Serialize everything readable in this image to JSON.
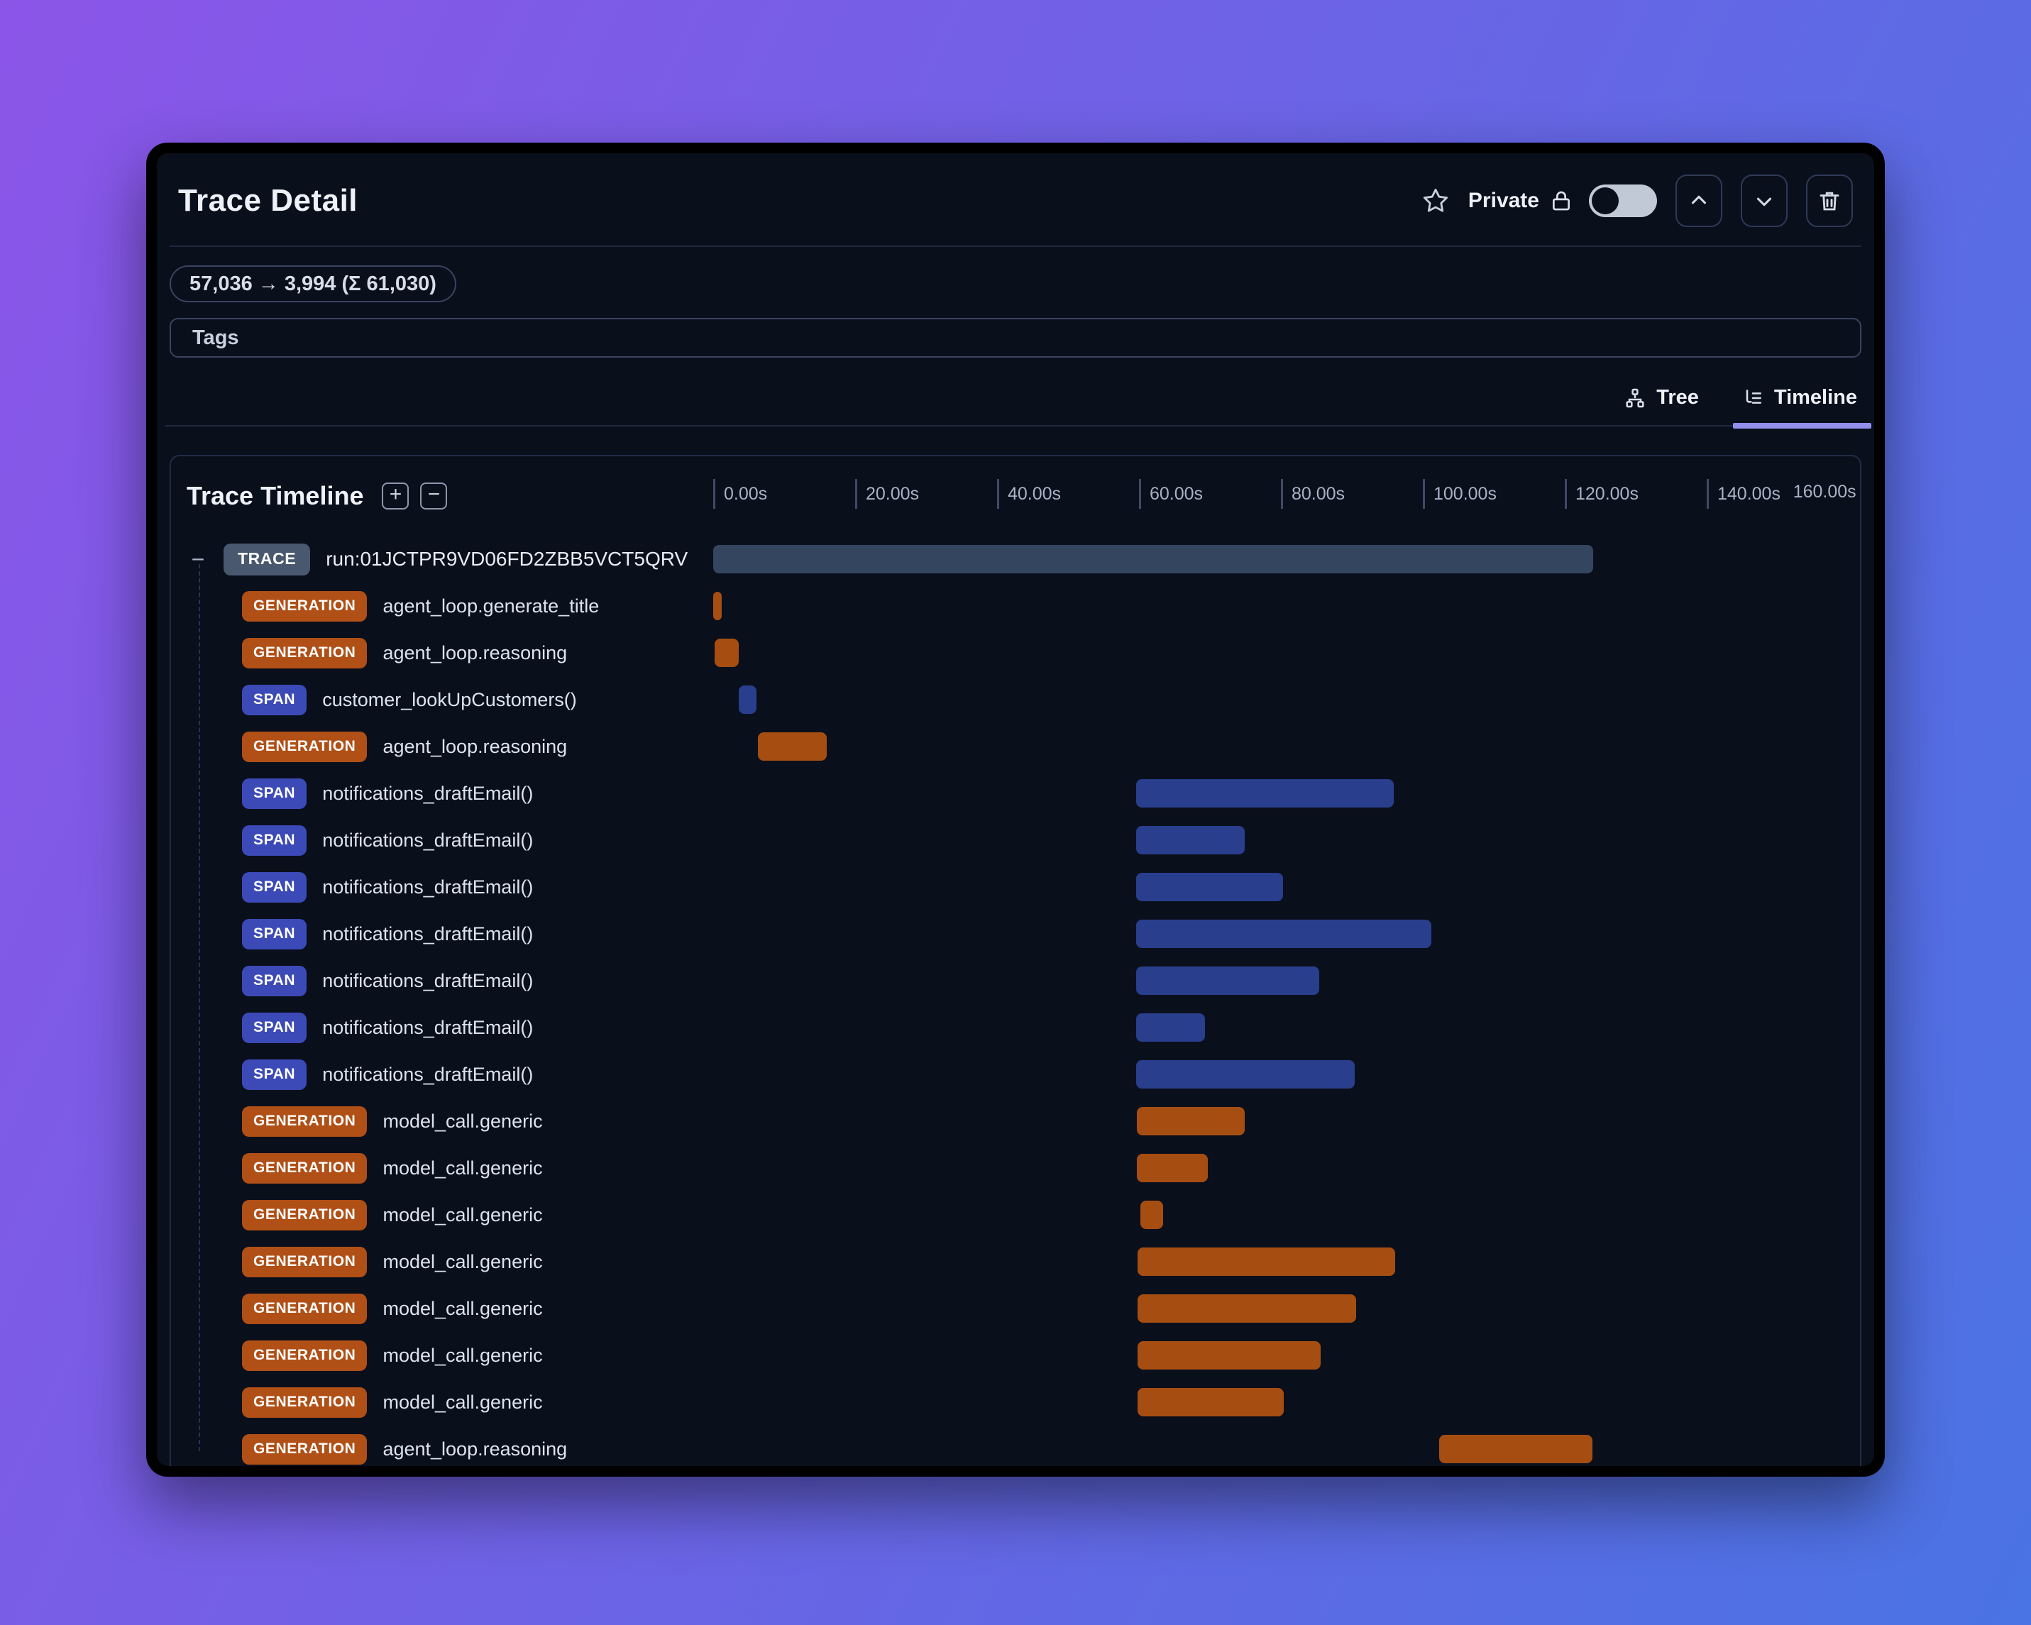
{
  "header": {
    "title": "Trace Detail",
    "privacy_label": "Private",
    "star_icon": "star-outline",
    "lock_icon": "padlock",
    "toggle_state": "off",
    "up_button_icon": "chevron-up",
    "down_button_icon": "chevron-down",
    "delete_button_icon": "trash"
  },
  "token_badge": "57,036 → 3,994 (Σ 61,030)",
  "tags": {
    "label": "Tags"
  },
  "tabs": [
    {
      "label": "Tree",
      "icon": "hierarchy-icon",
      "active": false
    },
    {
      "label": "Timeline",
      "icon": "list-tree-icon",
      "active": true
    }
  ],
  "timeline": {
    "title": "Trace Timeline",
    "expand_all_glyph": "+",
    "collapse_all_glyph": "−",
    "collapse_trace_glyph": "−",
    "axis": {
      "unit": "s",
      "max_s": 160,
      "ticks": [
        {
          "t": 0,
          "label": "0.00s"
        },
        {
          "t": 20,
          "label": "20.00s"
        },
        {
          "t": 40,
          "label": "40.00s"
        },
        {
          "t": 60,
          "label": "60.00s"
        },
        {
          "t": 80,
          "label": "80.00s"
        },
        {
          "t": 100,
          "label": "100.00s"
        },
        {
          "t": 120,
          "label": "120.00s"
        },
        {
          "t": 140,
          "label": "140.00s"
        }
      ],
      "end_label": "160.00s"
    },
    "rows": [
      {
        "kind": "trace",
        "badge": "TRACE",
        "label": "run:01JCTPR9VD06FD2ZBB5VCT5QRV",
        "start_s": 0,
        "end_s": 124.0
      },
      {
        "kind": "generation",
        "badge": "GENERATION",
        "label": "agent_loop.generate_title",
        "start_s": 0,
        "end_s": 1.2
      },
      {
        "kind": "generation",
        "badge": "GENERATION",
        "label": "agent_loop.reasoning",
        "start_s": 0.2,
        "end_s": 3.6
      },
      {
        "kind": "span",
        "badge": "SPAN",
        "label": "customer_lookUpCustomers()",
        "start_s": 3.6,
        "end_s": 6.1
      },
      {
        "kind": "generation",
        "badge": "GENERATION",
        "label": "agent_loop.reasoning",
        "start_s": 6.3,
        "end_s": 16.0
      },
      {
        "kind": "span",
        "badge": "SPAN",
        "label": "notifications_draftEmail()",
        "start_s": 59.6,
        "end_s": 95.9
      },
      {
        "kind": "span",
        "badge": "SPAN",
        "label": "notifications_draftEmail()",
        "start_s": 59.6,
        "end_s": 74.9
      },
      {
        "kind": "span",
        "badge": "SPAN",
        "label": "notifications_draftEmail()",
        "start_s": 59.6,
        "end_s": 80.3
      },
      {
        "kind": "span",
        "badge": "SPAN",
        "label": "notifications_draftEmail()",
        "start_s": 59.6,
        "end_s": 101.2
      },
      {
        "kind": "span",
        "badge": "SPAN",
        "label": "notifications_draftEmail()",
        "start_s": 59.6,
        "end_s": 85.4
      },
      {
        "kind": "span",
        "badge": "SPAN",
        "label": "notifications_draftEmail()",
        "start_s": 59.6,
        "end_s": 69.3
      },
      {
        "kind": "span",
        "badge": "SPAN",
        "label": "notifications_draftEmail()",
        "start_s": 59.6,
        "end_s": 90.4
      },
      {
        "kind": "generation",
        "badge": "GENERATION",
        "label": "model_call.generic",
        "start_s": 59.7,
        "end_s": 74.9
      },
      {
        "kind": "generation",
        "badge": "GENERATION",
        "label": "model_call.generic",
        "start_s": 59.7,
        "end_s": 69.7
      },
      {
        "kind": "generation",
        "badge": "GENERATION",
        "label": "model_call.generic",
        "start_s": 60.2,
        "end_s": 63.4
      },
      {
        "kind": "generation",
        "badge": "GENERATION",
        "label": "model_call.generic",
        "start_s": 59.8,
        "end_s": 96.1
      },
      {
        "kind": "generation",
        "badge": "GENERATION",
        "label": "model_call.generic",
        "start_s": 59.8,
        "end_s": 90.6
      },
      {
        "kind": "generation",
        "badge": "GENERATION",
        "label": "model_call.generic",
        "start_s": 59.8,
        "end_s": 85.6
      },
      {
        "kind": "generation",
        "badge": "GENERATION",
        "label": "model_call.generic",
        "start_s": 59.8,
        "end_s": 80.4
      },
      {
        "kind": "generation",
        "badge": "GENERATION",
        "label": "agent_loop.reasoning",
        "start_s": 102.3,
        "end_s": 123.9
      }
    ]
  },
  "colors": {
    "background_gradient_from": "#8b55e8",
    "background_gradient_to": "#4a73e3",
    "panel_background": "#0a0f1c",
    "active_tab_underline": "#938fed",
    "trace_badge": "#49586e",
    "trace_bar": "#34455f",
    "generation_badge": "#b04f16",
    "generation_bar": "#a64e12",
    "span_badge": "#3c4ab8",
    "span_bar": "#2a3e8e"
  }
}
